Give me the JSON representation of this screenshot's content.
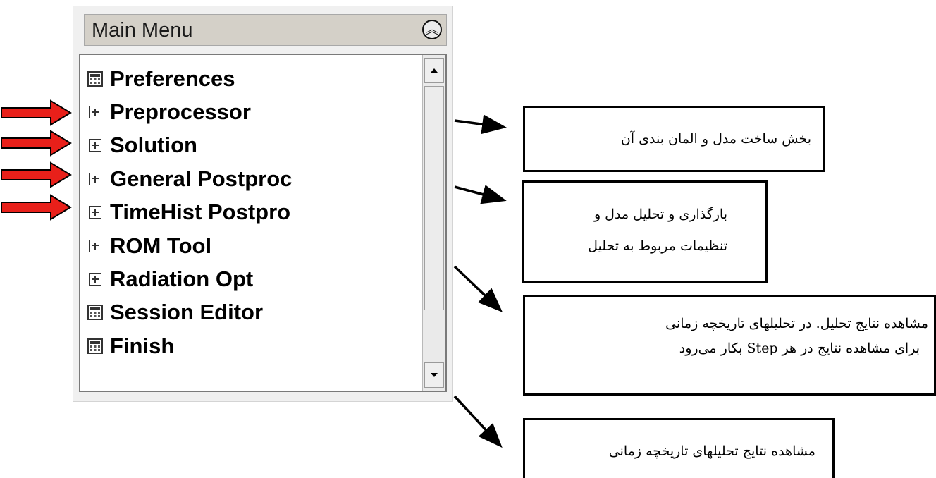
{
  "menu": {
    "title": "Main Menu",
    "collapse_icon_glyph": "⌃",
    "items": [
      {
        "label": "Preferences",
        "icon": "calculator-icon"
      },
      {
        "label": "Preprocessor",
        "icon": "expand-plus-icon"
      },
      {
        "label": "Solution",
        "icon": "expand-plus-icon"
      },
      {
        "label": "General Postproc",
        "icon": "expand-plus-icon"
      },
      {
        "label": "TimeHist Postpro",
        "icon": "expand-plus-icon"
      },
      {
        "label": "ROM Tool",
        "icon": "expand-plus-icon"
      },
      {
        "label": "Radiation Opt",
        "icon": "expand-plus-icon"
      },
      {
        "label": "Session Editor",
        "icon": "calculator-icon"
      },
      {
        "label": "Finish",
        "icon": "calculator-icon"
      }
    ]
  },
  "annotations": [
    {
      "lines": [
        "بخش ساخت مدل و المان بندی آن"
      ]
    },
    {
      "lines": [
        "بارگذاری و تحلیل مدل و",
        "تنظیمات مربوط به تحلیل"
      ]
    },
    {
      "lines": [
        "مشاهده نتایج تحلیل. در تحلیلهای تاریخچه زمانی",
        "برای مشاهده نتایج در هر Step بکار می‌رود"
      ]
    },
    {
      "lines": [
        "مشاهده نتایج تحلیلهای تاریخچه زمانی"
      ]
    }
  ],
  "colors": {
    "arrow_red": "#e8201a",
    "arrow_outline": "#000000"
  }
}
